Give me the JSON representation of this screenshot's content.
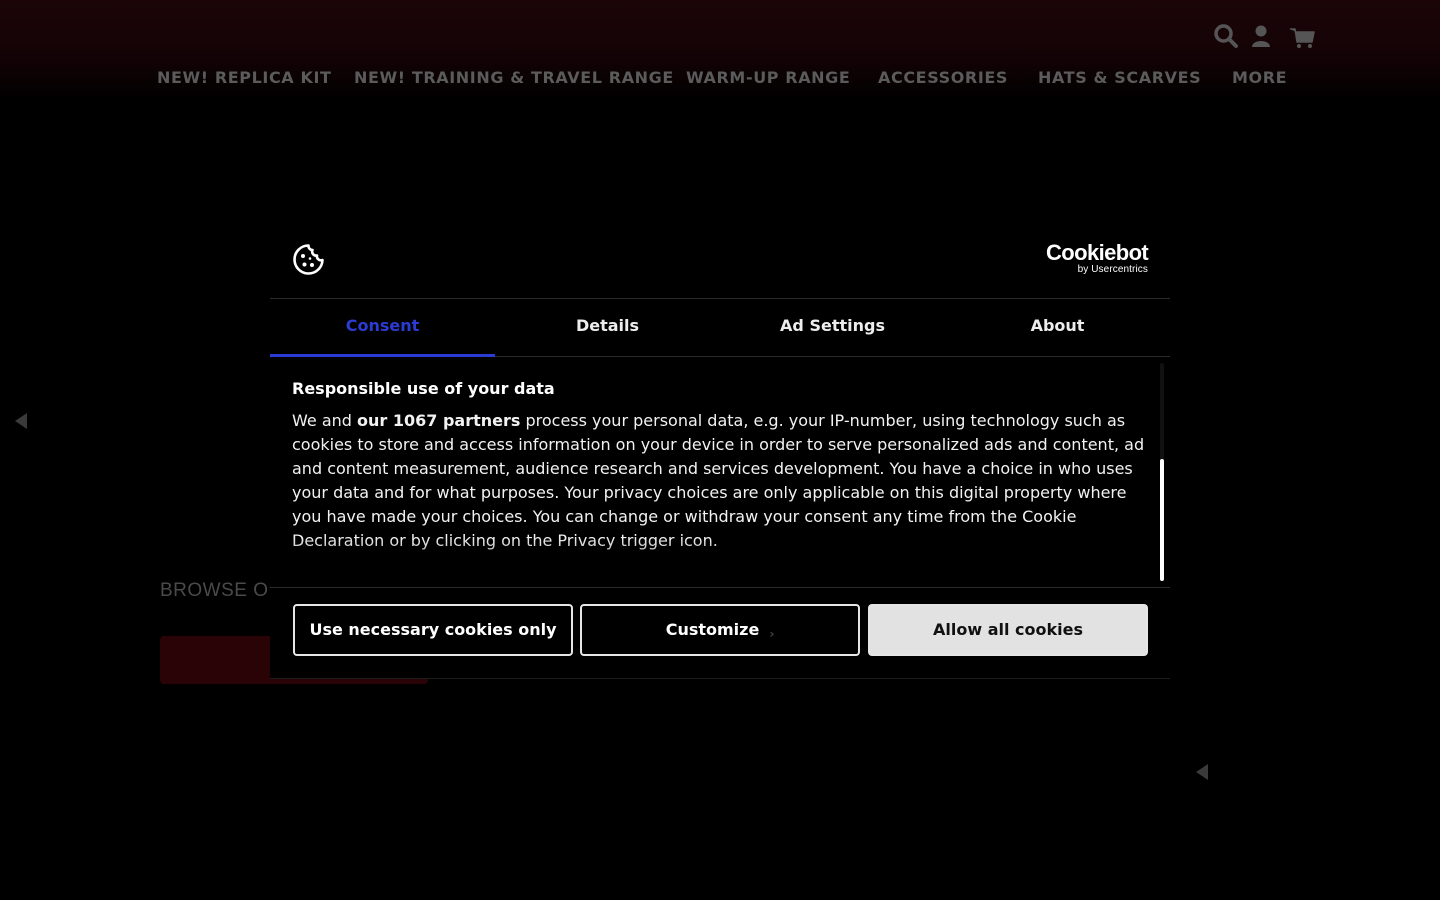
{
  "header": {
    "icons": [
      "search-icon",
      "account-icon",
      "cart-icon"
    ],
    "nav": [
      {
        "label": "NEW! REPLICA KIT"
      },
      {
        "label": "NEW! TRAINING & TRAVEL RANGE"
      },
      {
        "label": "WARM-UP RANGE"
      },
      {
        "label": "ACCESSORIES"
      },
      {
        "label": "HATS & SCARVES"
      },
      {
        "label": "MORE"
      }
    ]
  },
  "background": {
    "browse_text": "BROWSE OU"
  },
  "cookie_dialog": {
    "logo_icon": "cookie-icon",
    "brand": {
      "name": "Cookiebot",
      "tagline": "by Usercentrics"
    },
    "tabs": [
      {
        "label": "Consent",
        "active": true
      },
      {
        "label": "Details",
        "active": false
      },
      {
        "label": "Ad Settings",
        "active": false
      },
      {
        "label": "About",
        "active": false
      }
    ],
    "title": "Responsible use of your data",
    "text_before": "We and ",
    "text_bold": "our 1067 partners",
    "text_after": " process your personal data, e.g. your IP-number, using technology such as cookies to store and access information on your device in order to serve personalized ads and content, ad and content measurement, audience research and services development. You have a choice in who uses your data and for what purposes. Your privacy choices are only applicable on this digital property where you have made your choices. You can change or withdraw your consent any time from the Cookie Declaration or by clicking on the Privacy trigger icon.",
    "buttons": {
      "necessary": "Use necessary cookies only",
      "customize": "Customize",
      "allow_all": "Allow all cookies"
    }
  },
  "colors": {
    "accent": "#2b3bd3",
    "nav_text": "#5b5b5b",
    "background": "#000000"
  }
}
